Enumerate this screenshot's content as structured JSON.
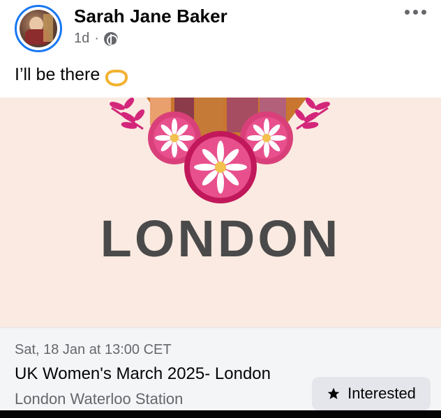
{
  "post": {
    "author": "Sarah Jane Baker",
    "time": "1d",
    "separator": "·",
    "text": "I’ll be there"
  },
  "icons": {
    "avatar": "profile-photo",
    "audience": "globe-icon",
    "more": "more-options-icon",
    "emoji": "heart-hands-emoji",
    "star": "star-icon"
  },
  "banner": {
    "city": "LONDON"
  },
  "event": {
    "date": "Sat, 18 Jan at 13:00 CET",
    "title": "UK Women's March 2025- London",
    "location": "London Waterloo Station",
    "interested_label": "Interested"
  },
  "colors": {
    "accent_ring": "#1877f2",
    "banner_bg": "#faeae1",
    "flower_pink": "#e8508d",
    "flower_dark": "#c1185b",
    "text_secondary": "#65676b"
  }
}
